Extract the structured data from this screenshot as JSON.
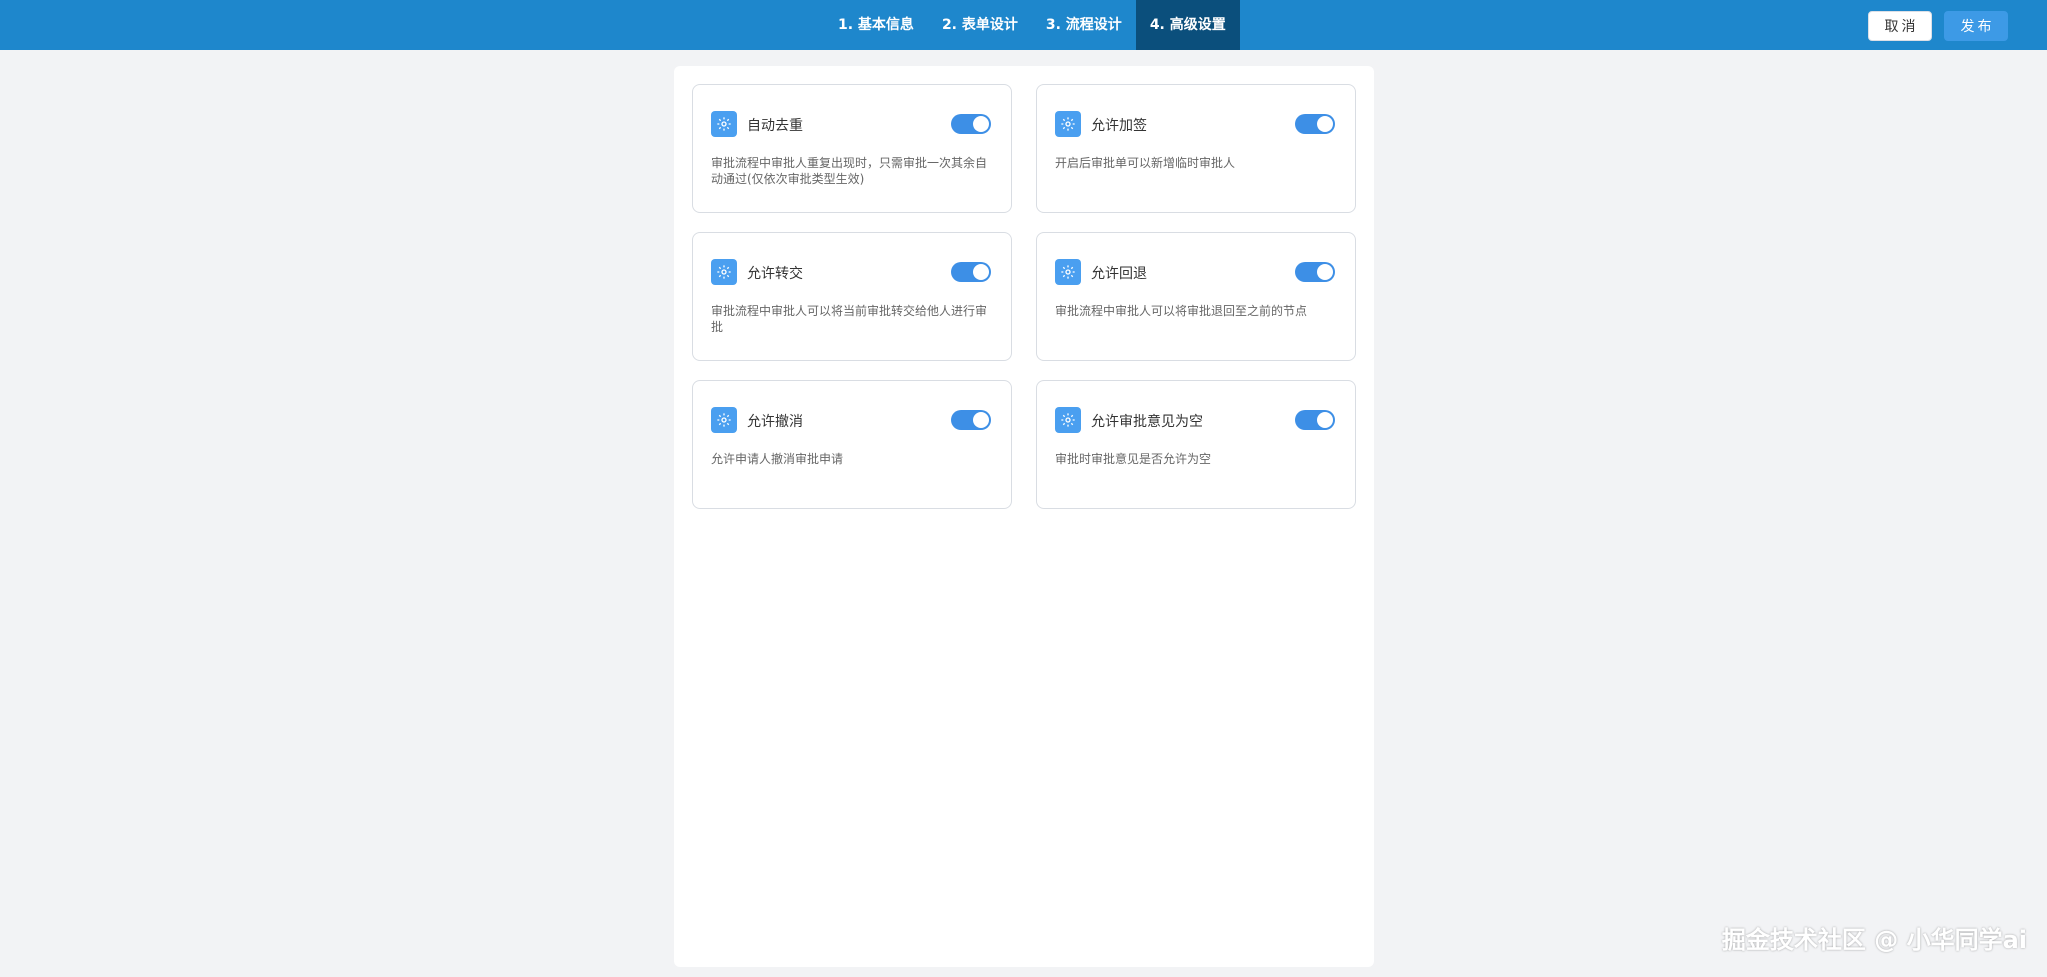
{
  "header": {
    "steps": [
      {
        "label": "1. 基本信息",
        "active": false
      },
      {
        "label": "2. 表单设计",
        "active": false
      },
      {
        "label": "3. 流程设计",
        "active": false
      },
      {
        "label": "4. 高级设置",
        "active": true
      }
    ],
    "cancel_label": "取消",
    "publish_label": "发布"
  },
  "settings": [
    {
      "icon": "gear-icon",
      "title": "自动去重",
      "enabled": true,
      "description": "审批流程中审批人重复出现时，只需审批一次其余自动通过(仅依次审批类型生效)"
    },
    {
      "icon": "gear-icon",
      "title": "允许加签",
      "enabled": true,
      "description": "开启后审批单可以新增临时审批人"
    },
    {
      "icon": "gear-icon",
      "title": "允许转交",
      "enabled": true,
      "description": "审批流程中审批人可以将当前审批转交给他人进行审批"
    },
    {
      "icon": "gear-icon",
      "title": "允许回退",
      "enabled": true,
      "description": "审批流程中审批人可以将审批退回至之前的节点"
    },
    {
      "icon": "gear-icon",
      "title": "允许撤消",
      "enabled": true,
      "description": "允许申请人撤消审批申请"
    },
    {
      "icon": "gear-icon",
      "title": "允许审批意见为空",
      "enabled": true,
      "description": "审批时审批意见是否允许为空"
    }
  ],
  "watermark": "掘金技术社区 @ 小华同学ai",
  "colors": {
    "header_bg": "#1e87cc",
    "active_step_bg": "#0b4f7c",
    "toggle_on": "#3d8fe6",
    "icon_bg": "#4a9ff0",
    "publish_bg": "#3d9ae6"
  }
}
